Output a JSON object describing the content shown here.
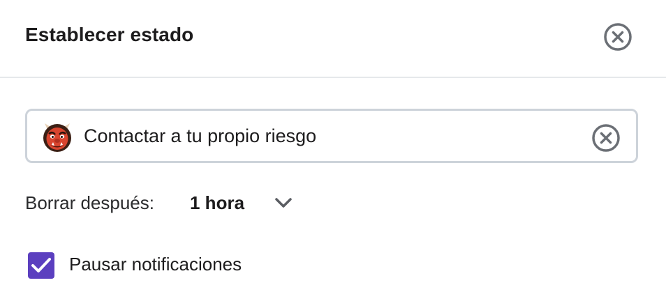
{
  "dialog": {
    "title": "Establecer estado",
    "close_icon": "close-circle-icon"
  },
  "status": {
    "emoji_icon": "red-ogre-emoji-icon",
    "text": "Contactar a tu propio riesgo",
    "clear_icon": "clear-circle-icon"
  },
  "clear_after": {
    "label": "Borrar después:",
    "value": "1 hora",
    "chevron_icon": "chevron-down-icon"
  },
  "pause_notifications": {
    "label": "Pausar notificaciones",
    "checked": true,
    "check_color": "#5b3fbf"
  },
  "colors": {
    "accent": "#5b3fbf",
    "border": "#cdd3da",
    "divider": "#e6e8eb"
  }
}
